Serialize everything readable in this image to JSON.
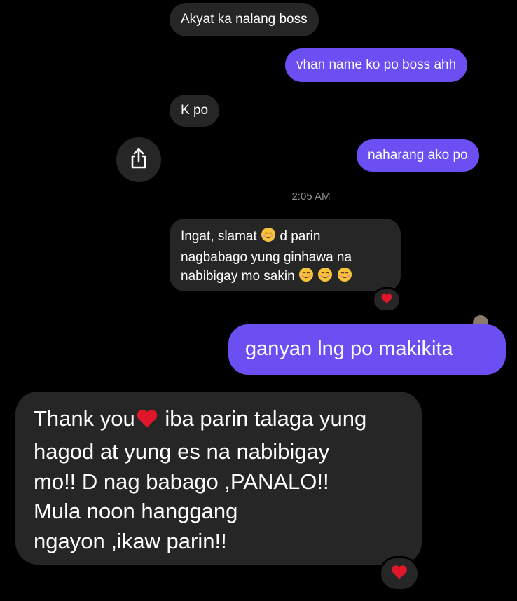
{
  "messages": [
    {
      "id": "m1",
      "direction": "incoming",
      "text": "Akyat ka nalang boss"
    },
    {
      "id": "m2",
      "direction": "outgoing",
      "text": "vhan name ko po boss ahh"
    },
    {
      "id": "m3",
      "direction": "incoming",
      "text": "K po"
    },
    {
      "id": "m4",
      "direction": "outgoing",
      "text": "naharang ako po"
    },
    {
      "id": "m5",
      "direction": "incoming",
      "lines": [
        "Ingat, slamat",
        "d parin",
        "nagbabago yung ginhawa na",
        "nabibigay mo sakin"
      ],
      "reaction": "heart"
    },
    {
      "id": "m6",
      "direction": "outgoing",
      "text": "ganyan lng po makikita"
    },
    {
      "id": "m7",
      "direction": "incoming",
      "lines": [
        "Thank you",
        "iba parin talaga yung",
        "hagod at yung es na nabibigay",
        "mo!! D nag babago ,PANALO!!",
        "Mula noon hanggang",
        "ngayon ,ikaw parin!!"
      ],
      "reaction": "heart"
    }
  ],
  "timestamp": "2:05 AM",
  "icons": {
    "share": "share-icon",
    "reaction": "heart-icon",
    "emoji": "relieved-face-emoji"
  },
  "colors": {
    "background": "#000000",
    "incoming_bubble": "#262626",
    "outgoing_bubble": "#6b4ff2",
    "timestamp": "#8e8e93",
    "heart": "#e0172b"
  }
}
